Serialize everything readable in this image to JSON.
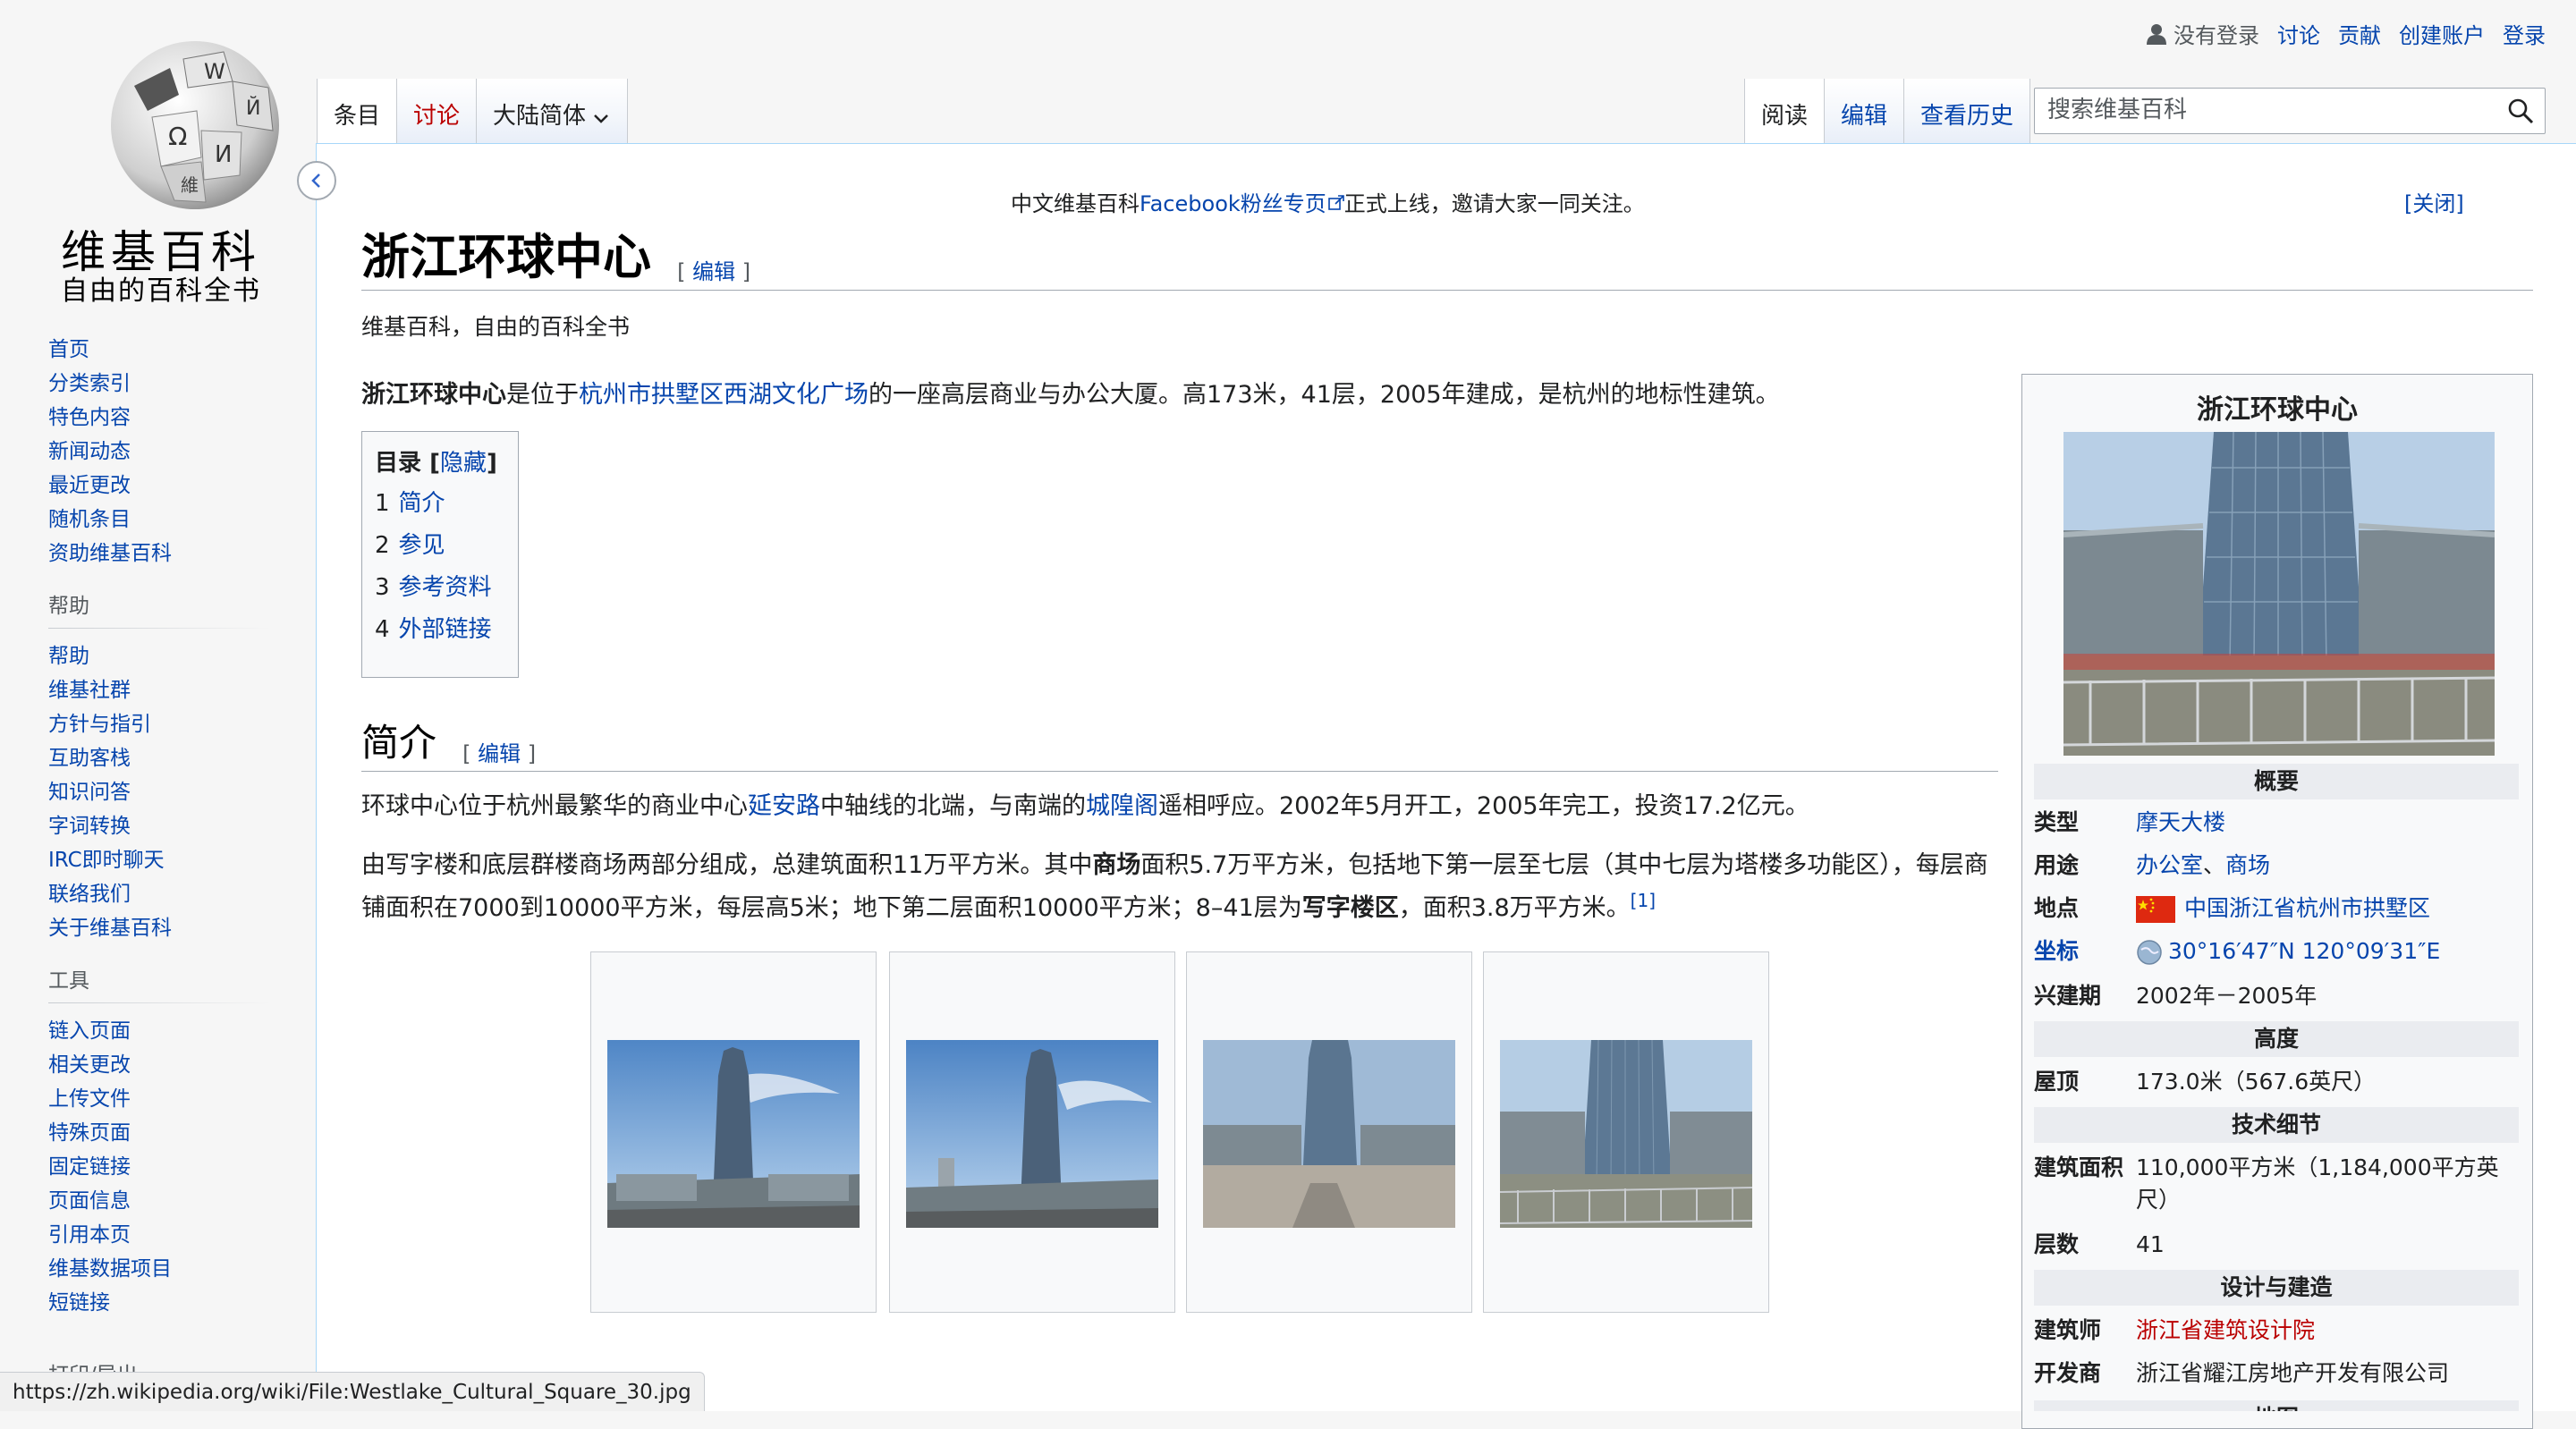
{
  "logo": {
    "wordmark": "维基百科",
    "tagline": "自由的百科全书"
  },
  "personal": {
    "user_status": "没有登录",
    "talk": "讨论",
    "contributions": "贡献",
    "create_account": "创建账户",
    "login": "登录"
  },
  "tabs": {
    "article": "条目",
    "talk": "讨论",
    "variant": "大陆简体",
    "read": "阅读",
    "edit": "编辑",
    "history": "查看历史"
  },
  "search": {
    "placeholder": "搜索维基百科"
  },
  "sidebar": {
    "nav": [
      "首页",
      "分类索引",
      "特色内容",
      "新闻动态",
      "最近更改",
      "随机条目",
      "资助维基百科"
    ],
    "help_heading": "帮助",
    "help": [
      "帮助",
      "维基社群",
      "方针与指引",
      "互助客栈",
      "知识问答",
      "字词转换",
      "IRC即时聊天",
      "联络我们",
      "关于维基百科"
    ],
    "tools_heading": "工具",
    "tools": [
      "链入页面",
      "相关更改",
      "上传文件",
      "特殊页面",
      "固定链接",
      "页面信息",
      "引用本页",
      "维基数据项目",
      "短链接"
    ],
    "print_heading": "打印/导出"
  },
  "notice": {
    "prefix": "中文维基百科",
    "link": "Facebook粉丝专页",
    "suffix": "正式上线，邀请大家一同关注。",
    "close": "[关闭]"
  },
  "article": {
    "title": "浙江环球中心",
    "edit_label": "编辑",
    "tagline": "维基百科，自由的百科全书",
    "lead_bold": "浙江环球中心",
    "lead_1": "是位于",
    "lead_link": "杭州市拱墅区西湖文化广场",
    "lead_2": "的一座高层商业与办公大厦。高173米，41层，2005年建成，是杭州的地标性建筑。"
  },
  "toc": {
    "title": "目录",
    "toggle": "隐藏",
    "items": [
      {
        "num": "1",
        "label": "简介"
      },
      {
        "num": "2",
        "label": "参见"
      },
      {
        "num": "3",
        "label": "参考资料"
      },
      {
        "num": "4",
        "label": "外部链接"
      }
    ]
  },
  "section": {
    "heading": "简介",
    "p1_a": "环球中心位于杭州最繁华的商业中心",
    "p1_link1": "延安路",
    "p1_b": "中轴线的北端，与南端的",
    "p1_link2": "城隍阁",
    "p1_c": "遥相呼应。2002年5月开工，2005年完工，投资17.2亿元。",
    "p2_a": "由写字楼和底层群楼商场两部分组成，总建筑面积11万平方米。其中",
    "p2_b1": "商场",
    "p2_b": "面积5.7万平方米，包括地下第一层至七层（其中七层为塔楼多功能区），每层商铺面积在7000到10000平方米，每层高5米；地下第二层面积10000平方米；8–41层为",
    "p2_b2": "写字楼区",
    "p2_c": "，面积3.8万平方米。",
    "ref": "[1]"
  },
  "infobox": {
    "title": "浙江环球中心",
    "h_overview": "概要",
    "type_label": "类型",
    "type_value": "摩天大楼",
    "use_label": "用途",
    "use_1": "办公室",
    "use_sep": "、",
    "use_2": "商场",
    "location_label": "地点",
    "location_value": "中国浙江省杭州市拱墅区",
    "coord_label": "坐标",
    "coord_value": "30°16′47″N 120°09′31″E",
    "built_label": "兴建期",
    "built_value": "2002年－2005年",
    "h_height": "高度",
    "roof_label": "屋顶",
    "roof_value": "173.0米（567.6英尺）",
    "h_tech": "技术细节",
    "area_label": "建筑面积",
    "area_value": "110,000平方米（1,184,000平方英尺）",
    "floors_label": "层数",
    "floors_value": "41",
    "h_design": "设计与建造",
    "architect_label": "建筑师",
    "architect_value": "浙江省建筑设计院",
    "developer_label": "开发商",
    "developer_value": "浙江省耀江房地产开发有限公司",
    "h_map": "地图"
  },
  "statusbar": {
    "url": "https://zh.wikipedia.org/wiki/File:Westlake_Cultural_Square_30.jpg"
  },
  "colors": {
    "link": "#0645ad",
    "redlink": "#ba0000",
    "border": "#a2a9b1",
    "content_border": "#a7d7f9"
  }
}
